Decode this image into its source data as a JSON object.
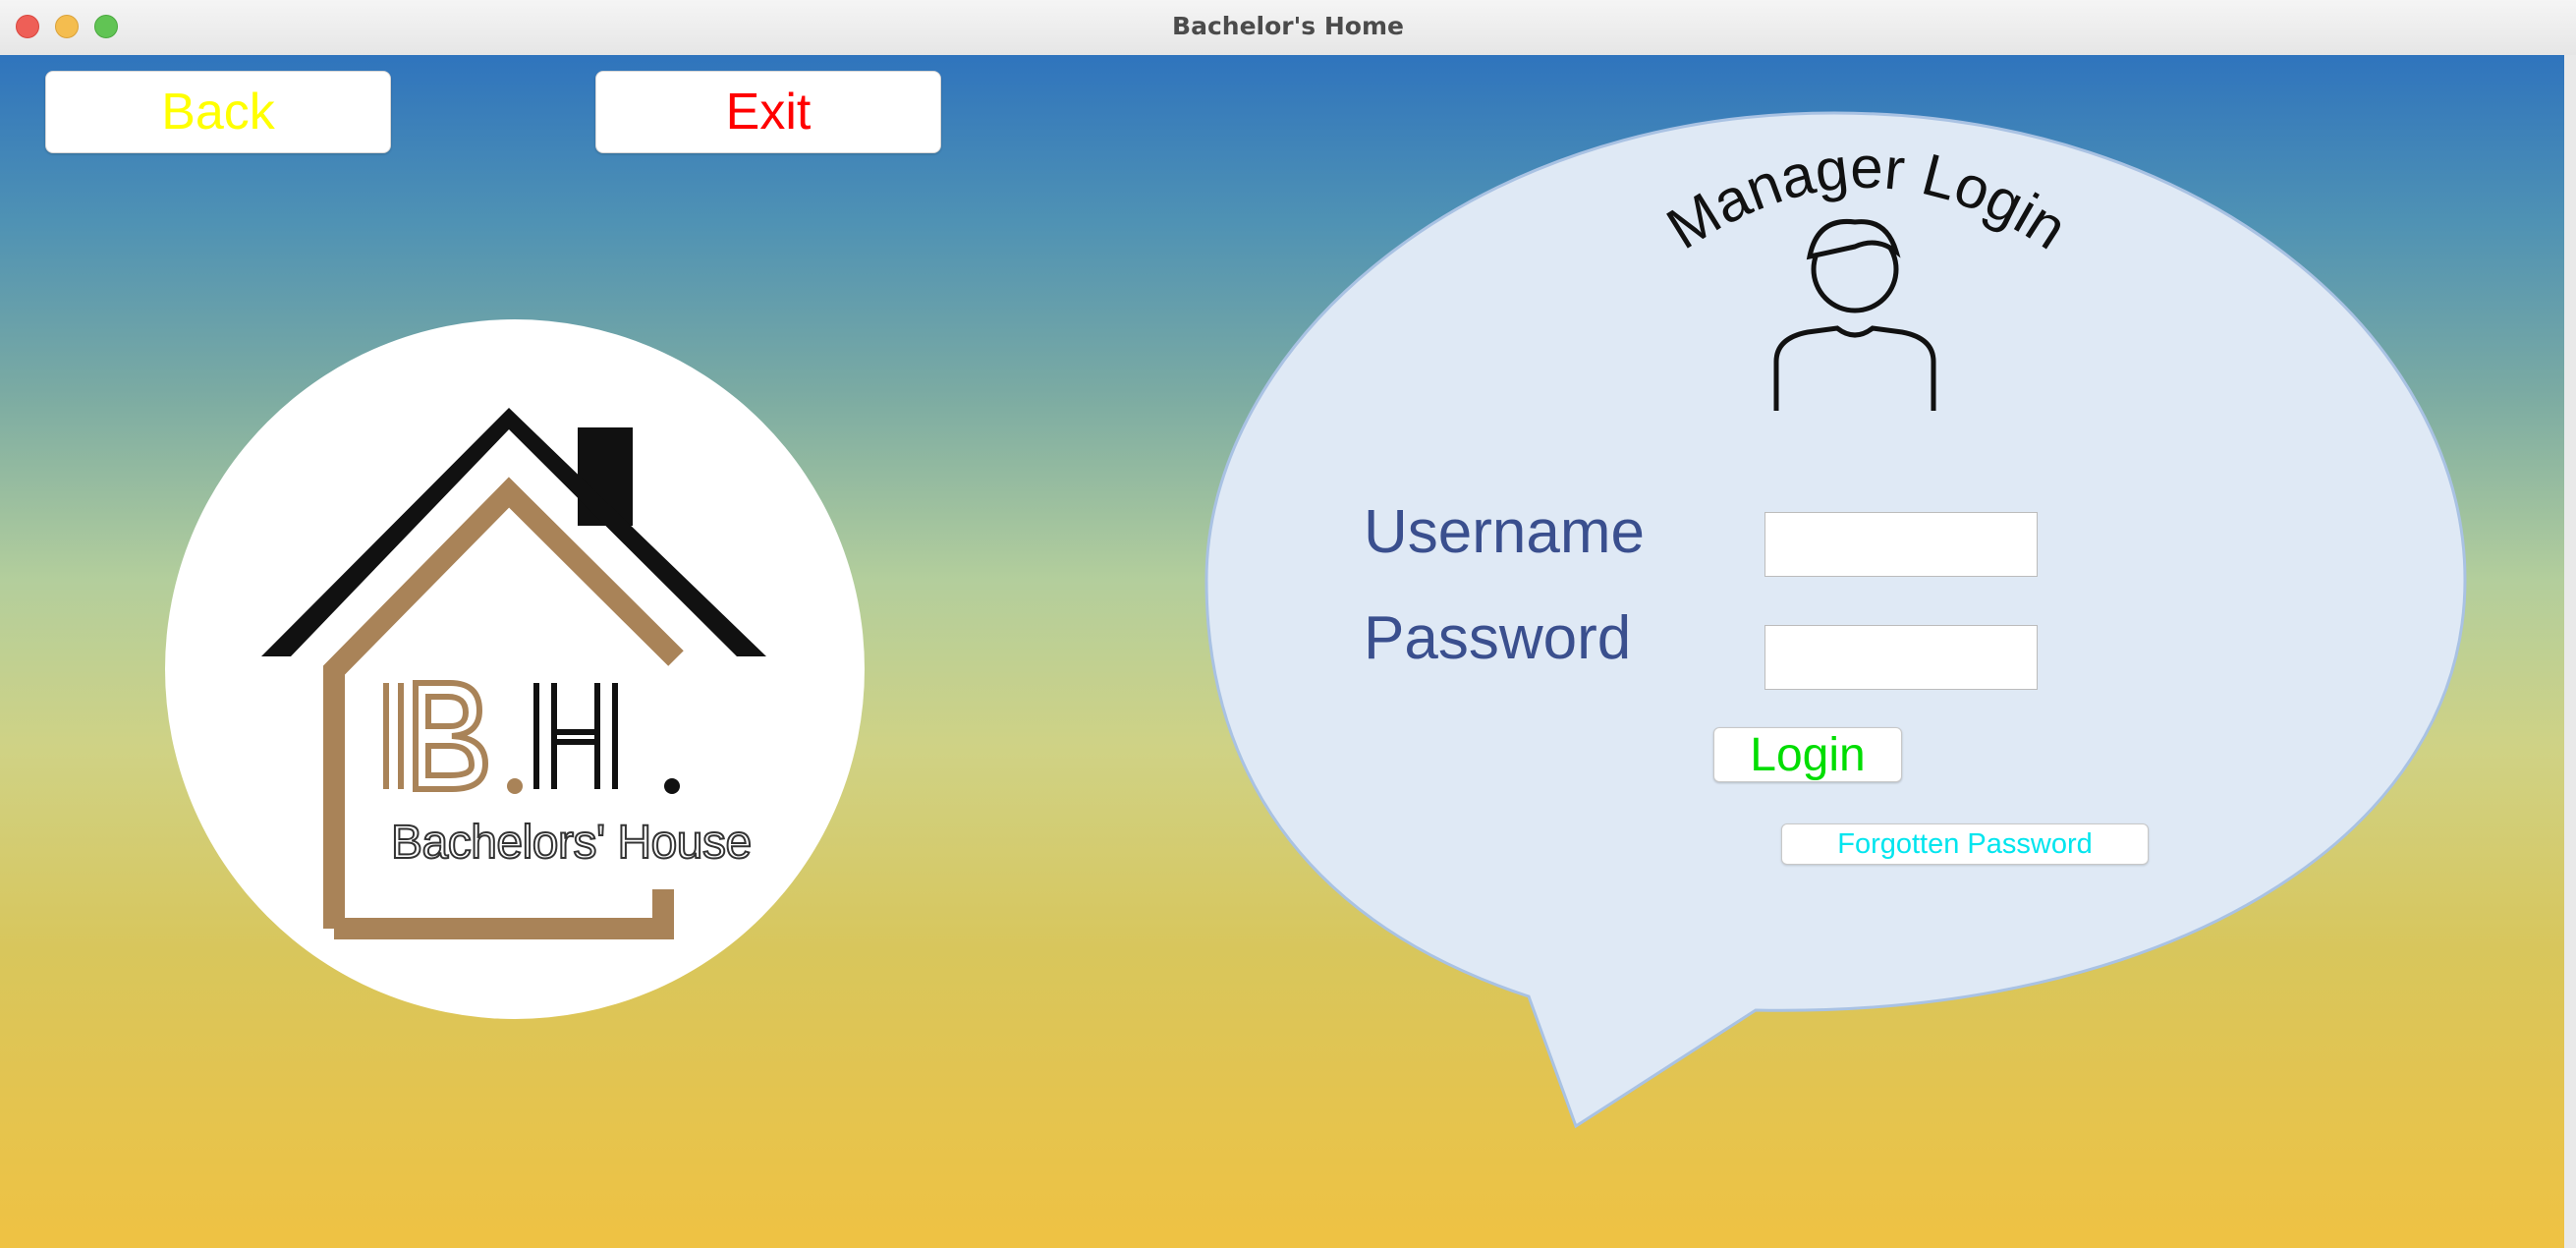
{
  "window": {
    "title": "Bachelor's Home"
  },
  "toolbar": {
    "back_label": "Back",
    "exit_label": "Exit"
  },
  "logo": {
    "initials_b": "B",
    "initials_dot1": ".",
    "initials_h": "H",
    "initials_dot2": ".",
    "tagline": "Bachelors' House"
  },
  "login": {
    "heading": "Manager Login",
    "username_label": "Username",
    "password_label": "Password",
    "username_value": "",
    "password_value": "",
    "login_label": "Login",
    "forgot_label": "Forgotten Password"
  },
  "colors": {
    "back_text": "#ffff00",
    "exit_text": "#ff0000",
    "login_text": "#00dd00",
    "forgot_text": "#00e5ee",
    "label_text": "#3a4f8e",
    "bubble_fill": "#dfe9f5",
    "logo_brown": "#a98358"
  },
  "icons": {
    "avatar": "user-silhouette-icon",
    "house": "house-logo-icon"
  }
}
